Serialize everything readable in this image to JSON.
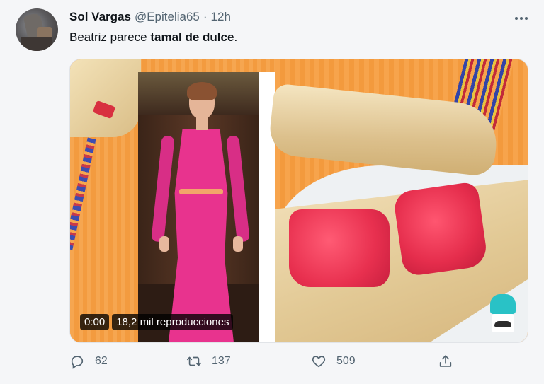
{
  "tweet": {
    "author_name": "Sol Vargas",
    "handle": "@Epitelia65",
    "separator": "·",
    "time": "12h",
    "text_plain": "Beatriz parece ",
    "text_bold": "tamal de dulce",
    "text_end": "."
  },
  "media": {
    "video_time": "0:00",
    "video_views": "18,2 mil reproducciones"
  },
  "actions": {
    "replies": "62",
    "retweets": "137",
    "likes": "509"
  },
  "icons": {
    "more": "more-horizontal-icon",
    "reply": "reply-icon",
    "retweet": "retweet-icon",
    "like": "heart-icon",
    "share": "share-icon",
    "watermark": "chef-mascot-icon"
  },
  "colors": {
    "text": "#0f1419",
    "secondary": "#536471",
    "background": "#f5f6f8"
  }
}
